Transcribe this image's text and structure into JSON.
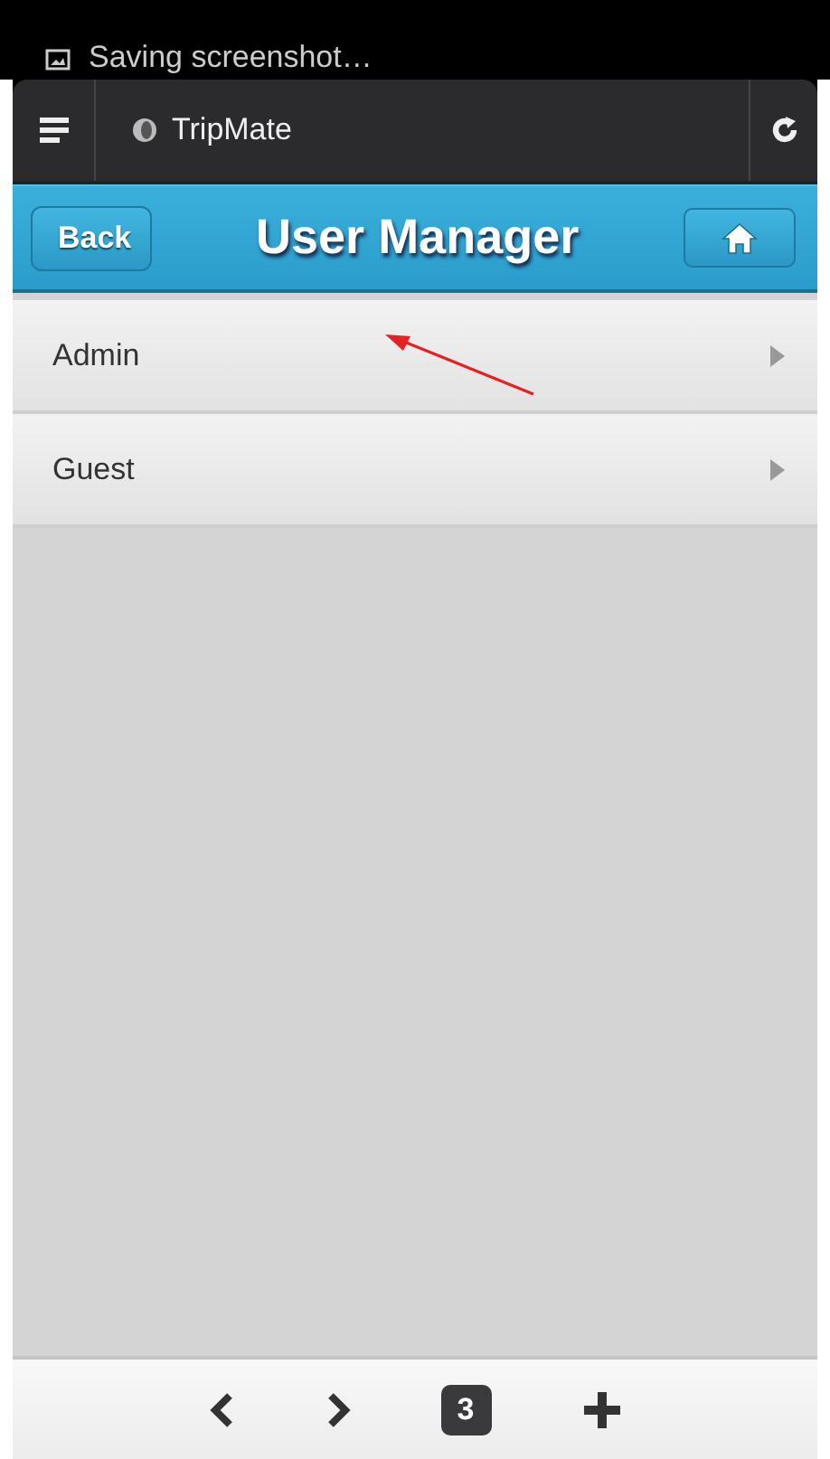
{
  "notification": {
    "text": "Saving screenshot…"
  },
  "browser_bar": {
    "title": "TripMate"
  },
  "header": {
    "back": "Back",
    "title": "User Manager"
  },
  "users": [
    {
      "name": "Admin"
    },
    {
      "name": "Guest"
    }
  ],
  "toolbar": {
    "tab_count": "3"
  }
}
